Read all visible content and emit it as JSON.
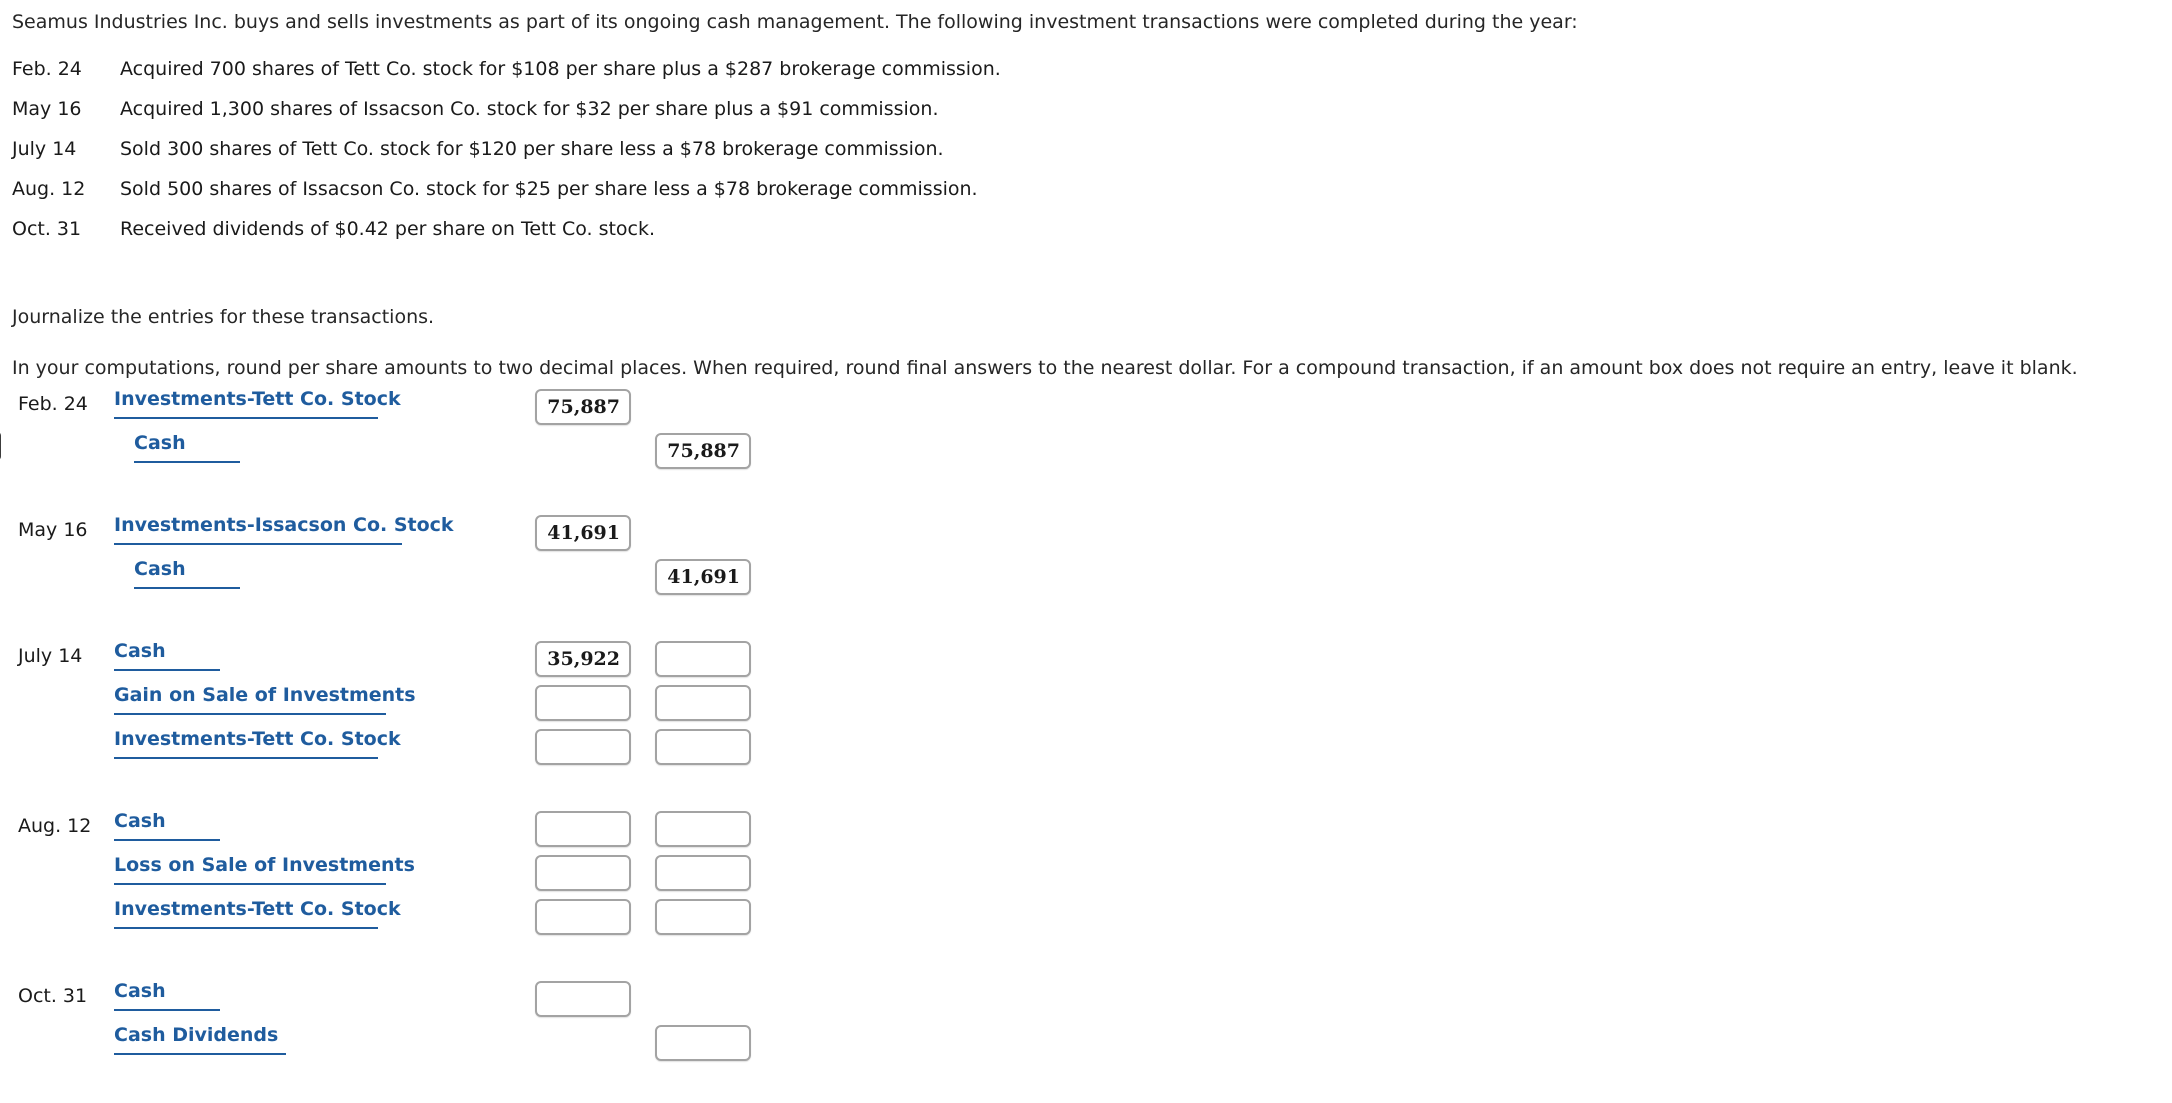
{
  "intro": {
    "text": "Seamus Industries Inc. buys and sells investments as part of its ongoing cash management. The following investment transactions were completed during the year:"
  },
  "transactions": [
    {
      "date": "Feb. 24",
      "description": "Acquired 700 shares of Tett Co. stock for $108 per share plus a $287 brokerage commission."
    },
    {
      "date": "May 16",
      "description": "Acquired 1,300 shares of Issacson Co. stock for $32 per share plus a $91 commission."
    },
    {
      "date": "July 14",
      "description": "Sold 300 shares of Tett Co. stock for $120 per share less a $78 brokerage commission."
    },
    {
      "date": "Aug. 12",
      "description": "Sold 500 shares of Issacson Co. stock for $25 per share less a $78 brokerage commission."
    },
    {
      "date": "Oct. 31",
      "description": "Received dividends of $0.42 per share on Tett Co. stock."
    }
  ],
  "instructions": {
    "line1": "Journalize the entries for these transactions.",
    "line2": "In your computations, round per share amounts to two decimal places. When required, round final answers to the nearest dollar. For a compound transaction, if an amount box does not require an entry, leave it blank."
  },
  "colors": {
    "account_label": "#1f5c9e",
    "box_border": "#a3a3a3",
    "text": "#1a1a1a"
  },
  "journal": {
    "entries": [
      {
        "date": "Feb. 24",
        "lines": [
          {
            "account": "Investments-Tett Co. Stock",
            "indent": 0,
            "underline_width": 264,
            "debit": "75,887",
            "credit": "",
            "has_debit_box": true,
            "has_credit_box": false
          },
          {
            "account": "Cash",
            "indent": 1,
            "underline_width": 106,
            "debit": "",
            "credit": "75,887",
            "has_debit_box": false,
            "has_credit_box": true
          }
        ]
      },
      {
        "date": "May 16",
        "lines": [
          {
            "account": "Investments-Issacson Co. Stock",
            "indent": 0,
            "underline_width": 288,
            "debit": "41,691",
            "credit": "",
            "has_debit_box": true,
            "has_credit_box": false
          },
          {
            "account": "Cash",
            "indent": 1,
            "underline_width": 106,
            "debit": "",
            "credit": "41,691",
            "has_debit_box": false,
            "has_credit_box": true
          }
        ]
      },
      {
        "date": "July 14",
        "lines": [
          {
            "account": "Cash",
            "indent": 0,
            "underline_width": 106,
            "debit": "35,922",
            "credit": "",
            "has_debit_box": true,
            "has_credit_box": true
          },
          {
            "account": "Gain on Sale of Investments",
            "indent": 0,
            "underline_width": 272,
            "debit": "",
            "credit": "",
            "has_debit_box": true,
            "has_credit_box": true
          },
          {
            "account": "Investments-Tett Co. Stock",
            "indent": 0,
            "underline_width": 264,
            "debit": "",
            "credit": "",
            "has_debit_box": true,
            "has_credit_box": true
          }
        ]
      },
      {
        "date": "Aug. 12",
        "lines": [
          {
            "account": "Cash",
            "indent": 0,
            "underline_width": 106,
            "debit": "",
            "credit": "",
            "has_debit_box": true,
            "has_credit_box": true
          },
          {
            "account": "Loss on Sale of Investments",
            "indent": 0,
            "underline_width": 272,
            "debit": "",
            "credit": "",
            "has_debit_box": true,
            "has_credit_box": true
          },
          {
            "account": "Investments-Tett Co. Stock",
            "indent": 0,
            "underline_width": 264,
            "debit": "",
            "credit": "",
            "has_debit_box": true,
            "has_credit_box": true
          }
        ]
      },
      {
        "date": "Oct. 31",
        "lines": [
          {
            "account": "Cash",
            "indent": 0,
            "underline_width": 106,
            "debit": "",
            "credit": "",
            "has_debit_box": true,
            "has_credit_box": false
          },
          {
            "account": "Cash Dividends",
            "indent": 0,
            "underline_width": 172,
            "debit": "",
            "credit": "",
            "has_debit_box": false,
            "has_credit_box": true
          }
        ]
      }
    ]
  }
}
